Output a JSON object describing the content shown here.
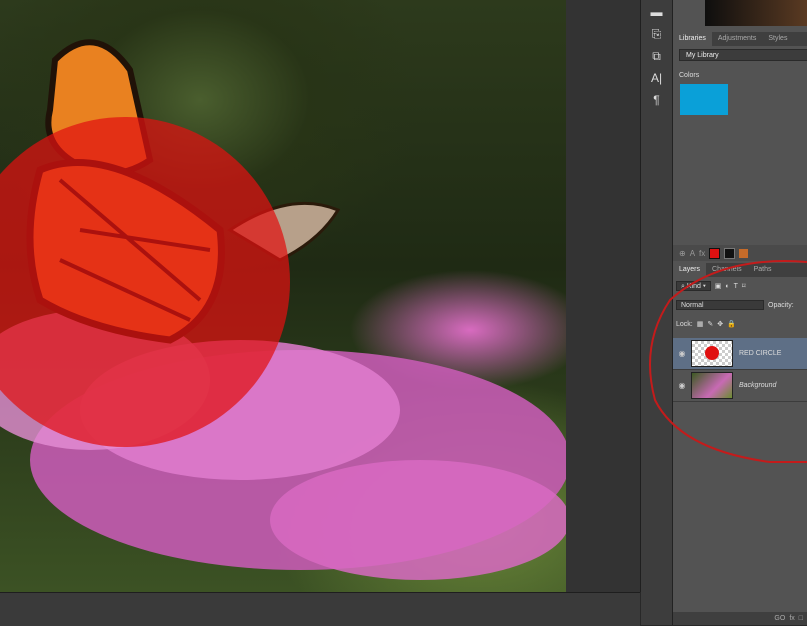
{
  "libraries_panel": {
    "tabs": [
      "Libraries",
      "Adjustments",
      "Styles"
    ],
    "library_name": "My Library",
    "colors_label": "Colors",
    "color_swatch": "#0aa0d8"
  },
  "layers_panel": {
    "tabs": [
      "Layers",
      "Channels",
      "Paths"
    ],
    "filter_kind": "Kind",
    "blend_mode": "Normal",
    "opacity_label": "Opacity:",
    "lock_label": "Lock:",
    "layers": [
      {
        "name": "RED CIRCLE",
        "selected": true
      },
      {
        "name": "Background",
        "selected": false
      }
    ]
  },
  "status_bar": {
    "icons": [
      "GO",
      "fx",
      "□"
    ]
  },
  "colors": {
    "red_circle": "#e01010",
    "annotation": "#c41b1b",
    "selection": "#5e6f86"
  }
}
